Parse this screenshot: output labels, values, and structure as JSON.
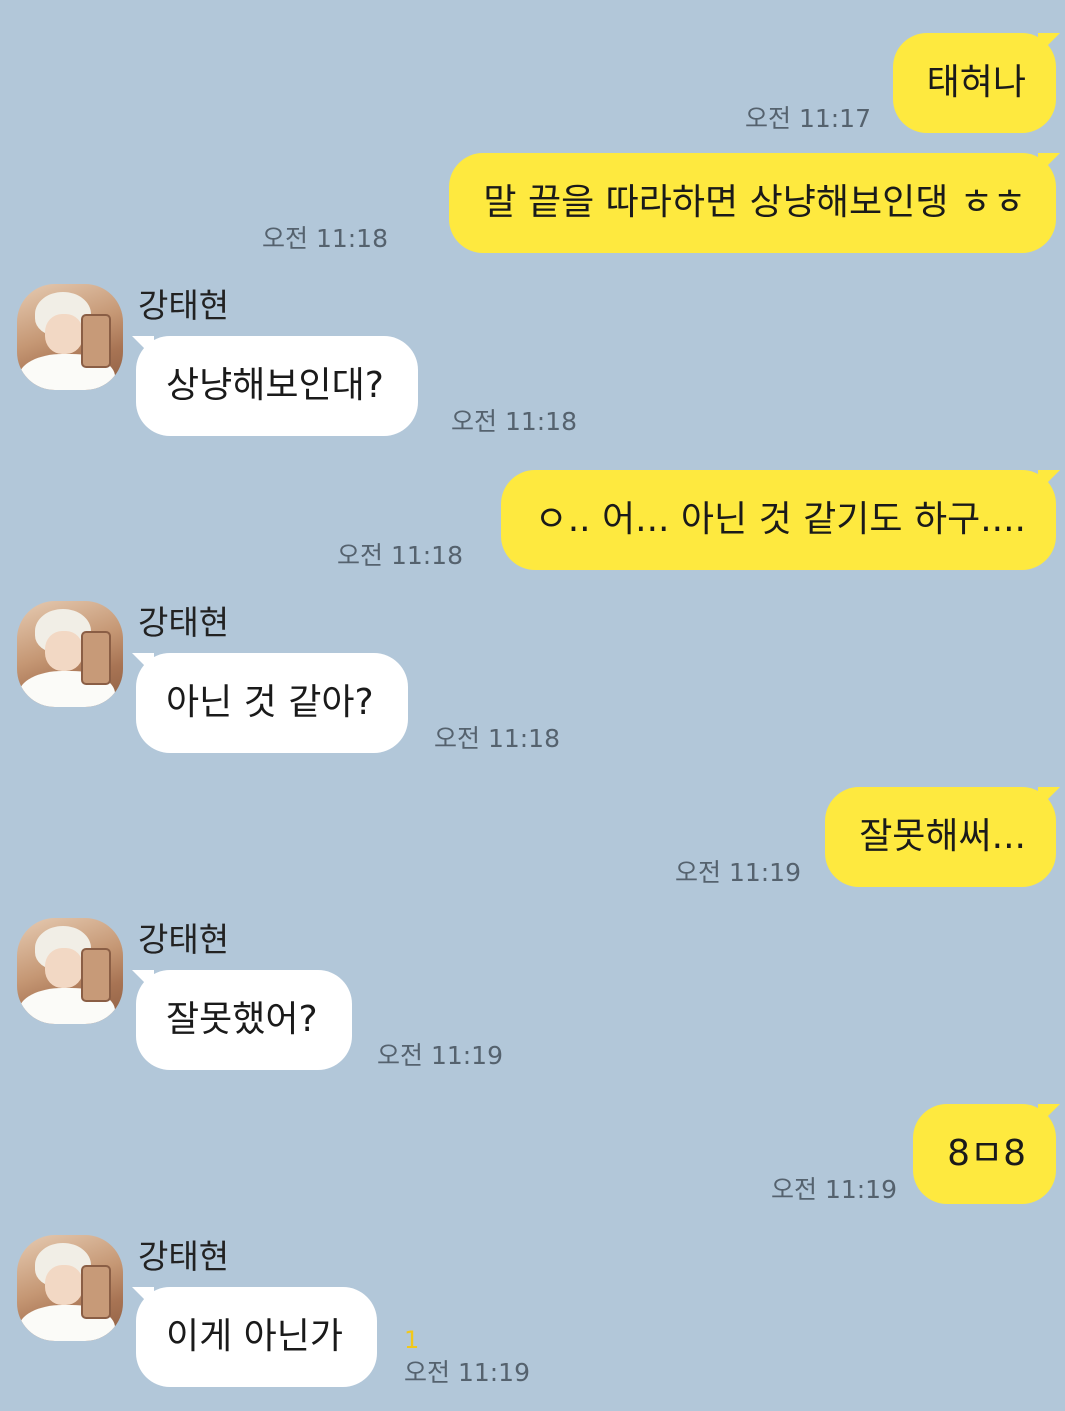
{
  "contact": {
    "name": "강태현",
    "avatar_icon": "profile-photo"
  },
  "colors": {
    "background": "#b2c7d9",
    "my_bubble": "#fee93f",
    "their_bubble": "#ffffff",
    "unread_count": "#f2c81a"
  },
  "messages": [
    {
      "sender": "me",
      "text": "태혀나",
      "time": "오전 11:17"
    },
    {
      "sender": "me",
      "text": "말 끝을 따라하면 상냥해보인댕 ㅎㅎ",
      "time": "오전 11:18"
    },
    {
      "sender": "contact",
      "name": "강태현",
      "text": "상냥해보인대?",
      "time": "오전 11:18"
    },
    {
      "sender": "me",
      "text": "ㅇ.. 어... 아닌 것 같기도 하구....",
      "time": "오전 11:18"
    },
    {
      "sender": "contact",
      "name": "강태현",
      "text": "아닌 것 같아?",
      "time": "오전 11:18"
    },
    {
      "sender": "me",
      "text": "잘못해써...",
      "time": "오전 11:19"
    },
    {
      "sender": "contact",
      "name": "강태현",
      "text": "잘못했어?",
      "time": "오전 11:19"
    },
    {
      "sender": "me",
      "text": "8ㅁ8",
      "time": "오전 11:19"
    },
    {
      "sender": "contact",
      "name": "강태현",
      "text": "이게 아닌가",
      "time": "오전 11:19",
      "unread": "1"
    }
  ]
}
